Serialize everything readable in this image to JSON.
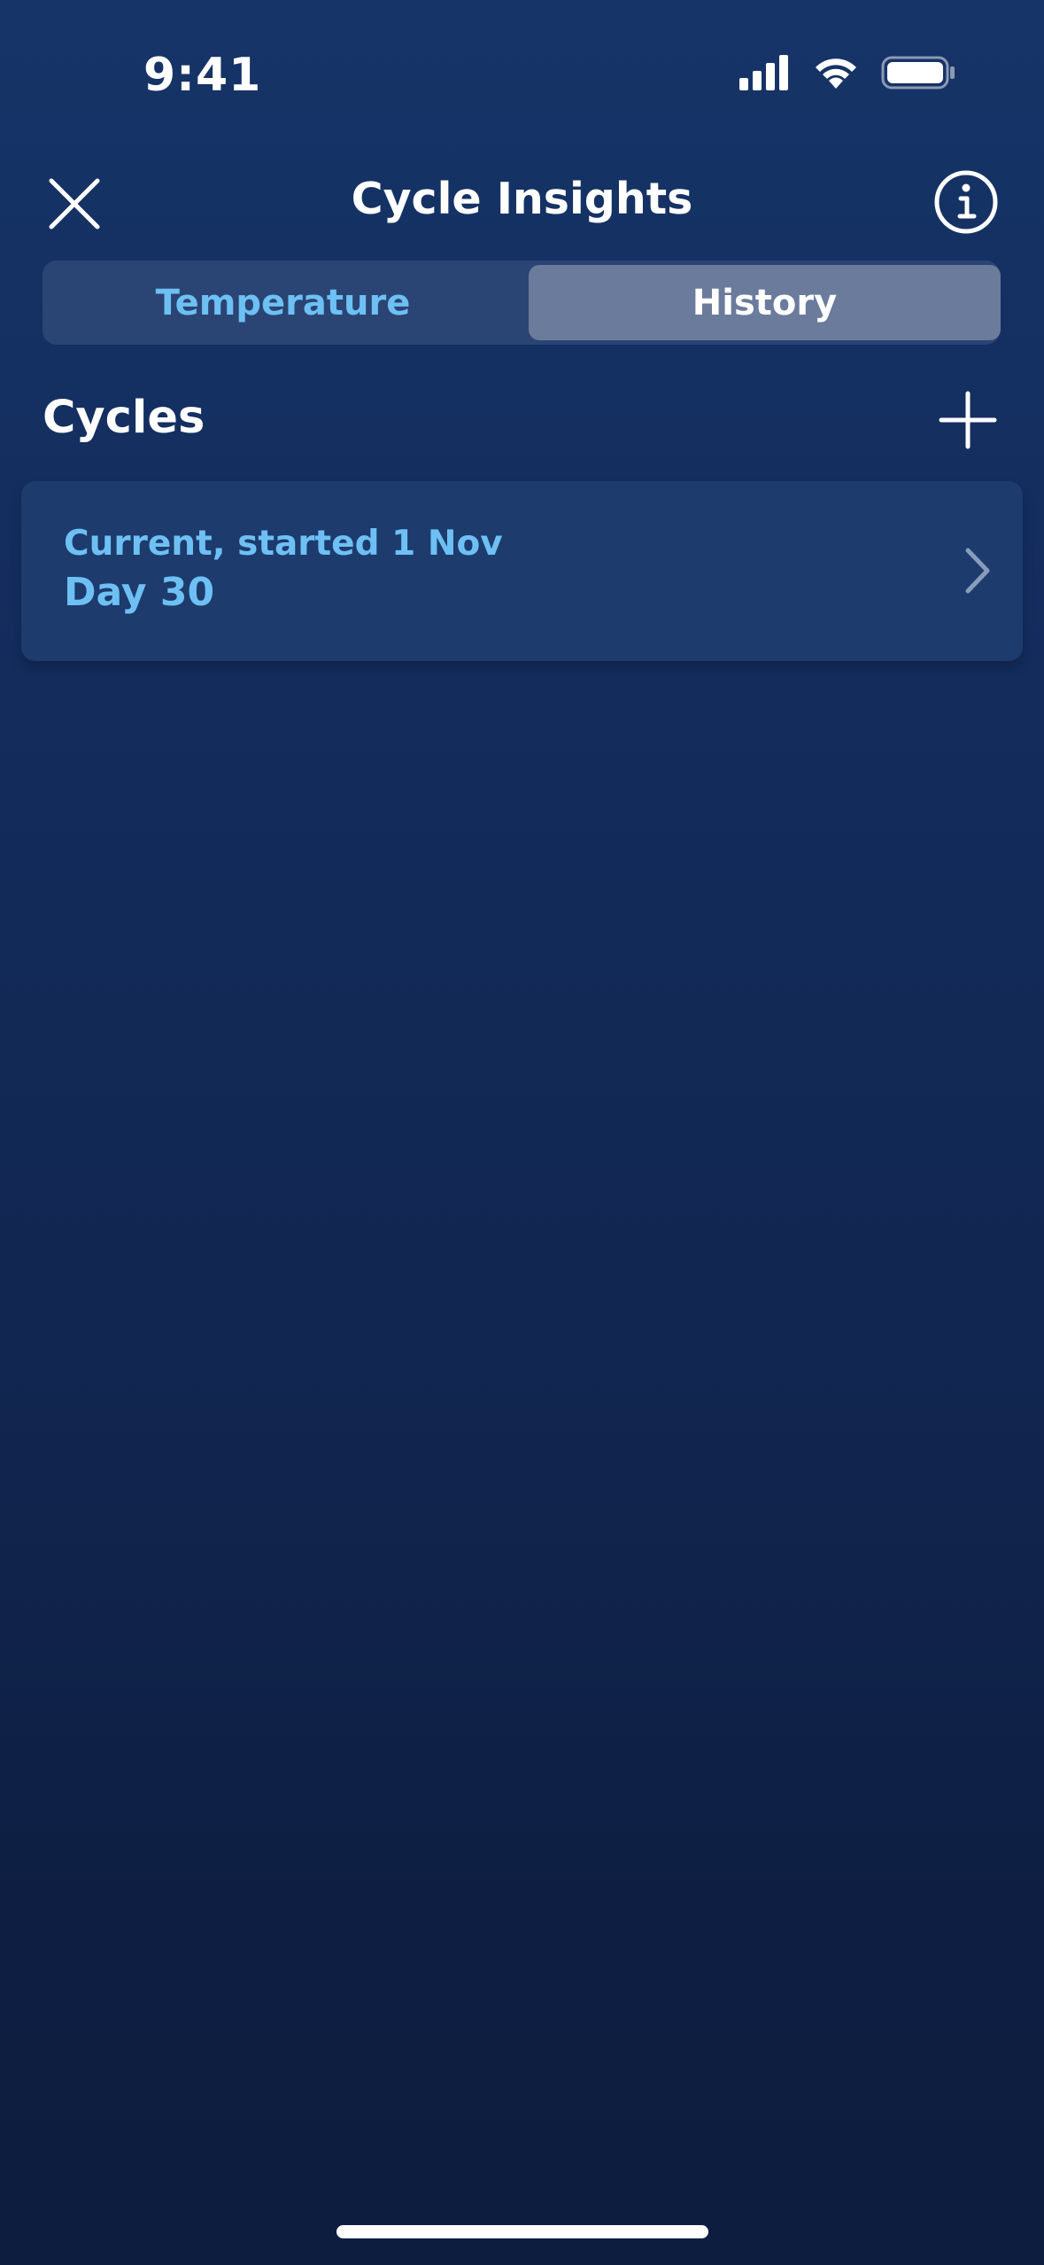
{
  "status_bar": {
    "time": "9:41"
  },
  "nav": {
    "title": "Cycle Insights",
    "close_icon": "close-icon",
    "info_icon": "info-icon"
  },
  "tabs": [
    {
      "label": "Temperature",
      "selected": false
    },
    {
      "label": "History",
      "selected": true
    }
  ],
  "section": {
    "title": "Cycles",
    "add_icon": "plus-icon"
  },
  "cycles": [
    {
      "subtitle": "Current, started 1 Nov",
      "day": "Day 30"
    }
  ],
  "colors": {
    "accent": "#6ec0f4",
    "background_top": "#163468",
    "background_bottom": "#0d1d40",
    "card": "#1d3b6d",
    "segment_selected": "#6a7b9c"
  }
}
